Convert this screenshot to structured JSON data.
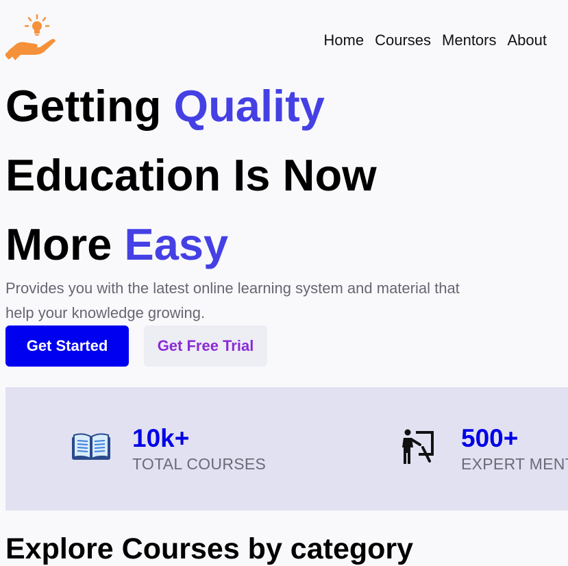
{
  "header": {
    "logo_icon": "hand-lightbulb-icon",
    "nav": [
      "Home",
      "Courses",
      "Mentors",
      "About"
    ]
  },
  "hero": {
    "line1": {
      "plain": "Getting ",
      "accent": "Quality"
    },
    "line2": {
      "plain": "Education Is Now"
    },
    "line3": {
      "plain": "More ",
      "accent": "Easy"
    },
    "subtitle": "Provides you with the latest online learning system and material that help your knowledge growing.",
    "primary_button": "Get Started",
    "secondary_button": "Get Free Trial"
  },
  "stats": [
    {
      "icon": "open-book-icon",
      "value": "10k+",
      "label": "TOTAL COURSES"
    },
    {
      "icon": "teacher-board-icon",
      "value": "500+",
      "label": "EXPERT MENTORS"
    }
  ],
  "section": {
    "title": "Explore Courses by category"
  },
  "colors": {
    "accent": "#4540e4",
    "primary_button": "#0000f0",
    "secondary_text": "#8a2bd6",
    "stats_band": "#e2e1f2",
    "logo": "#f5913a"
  }
}
